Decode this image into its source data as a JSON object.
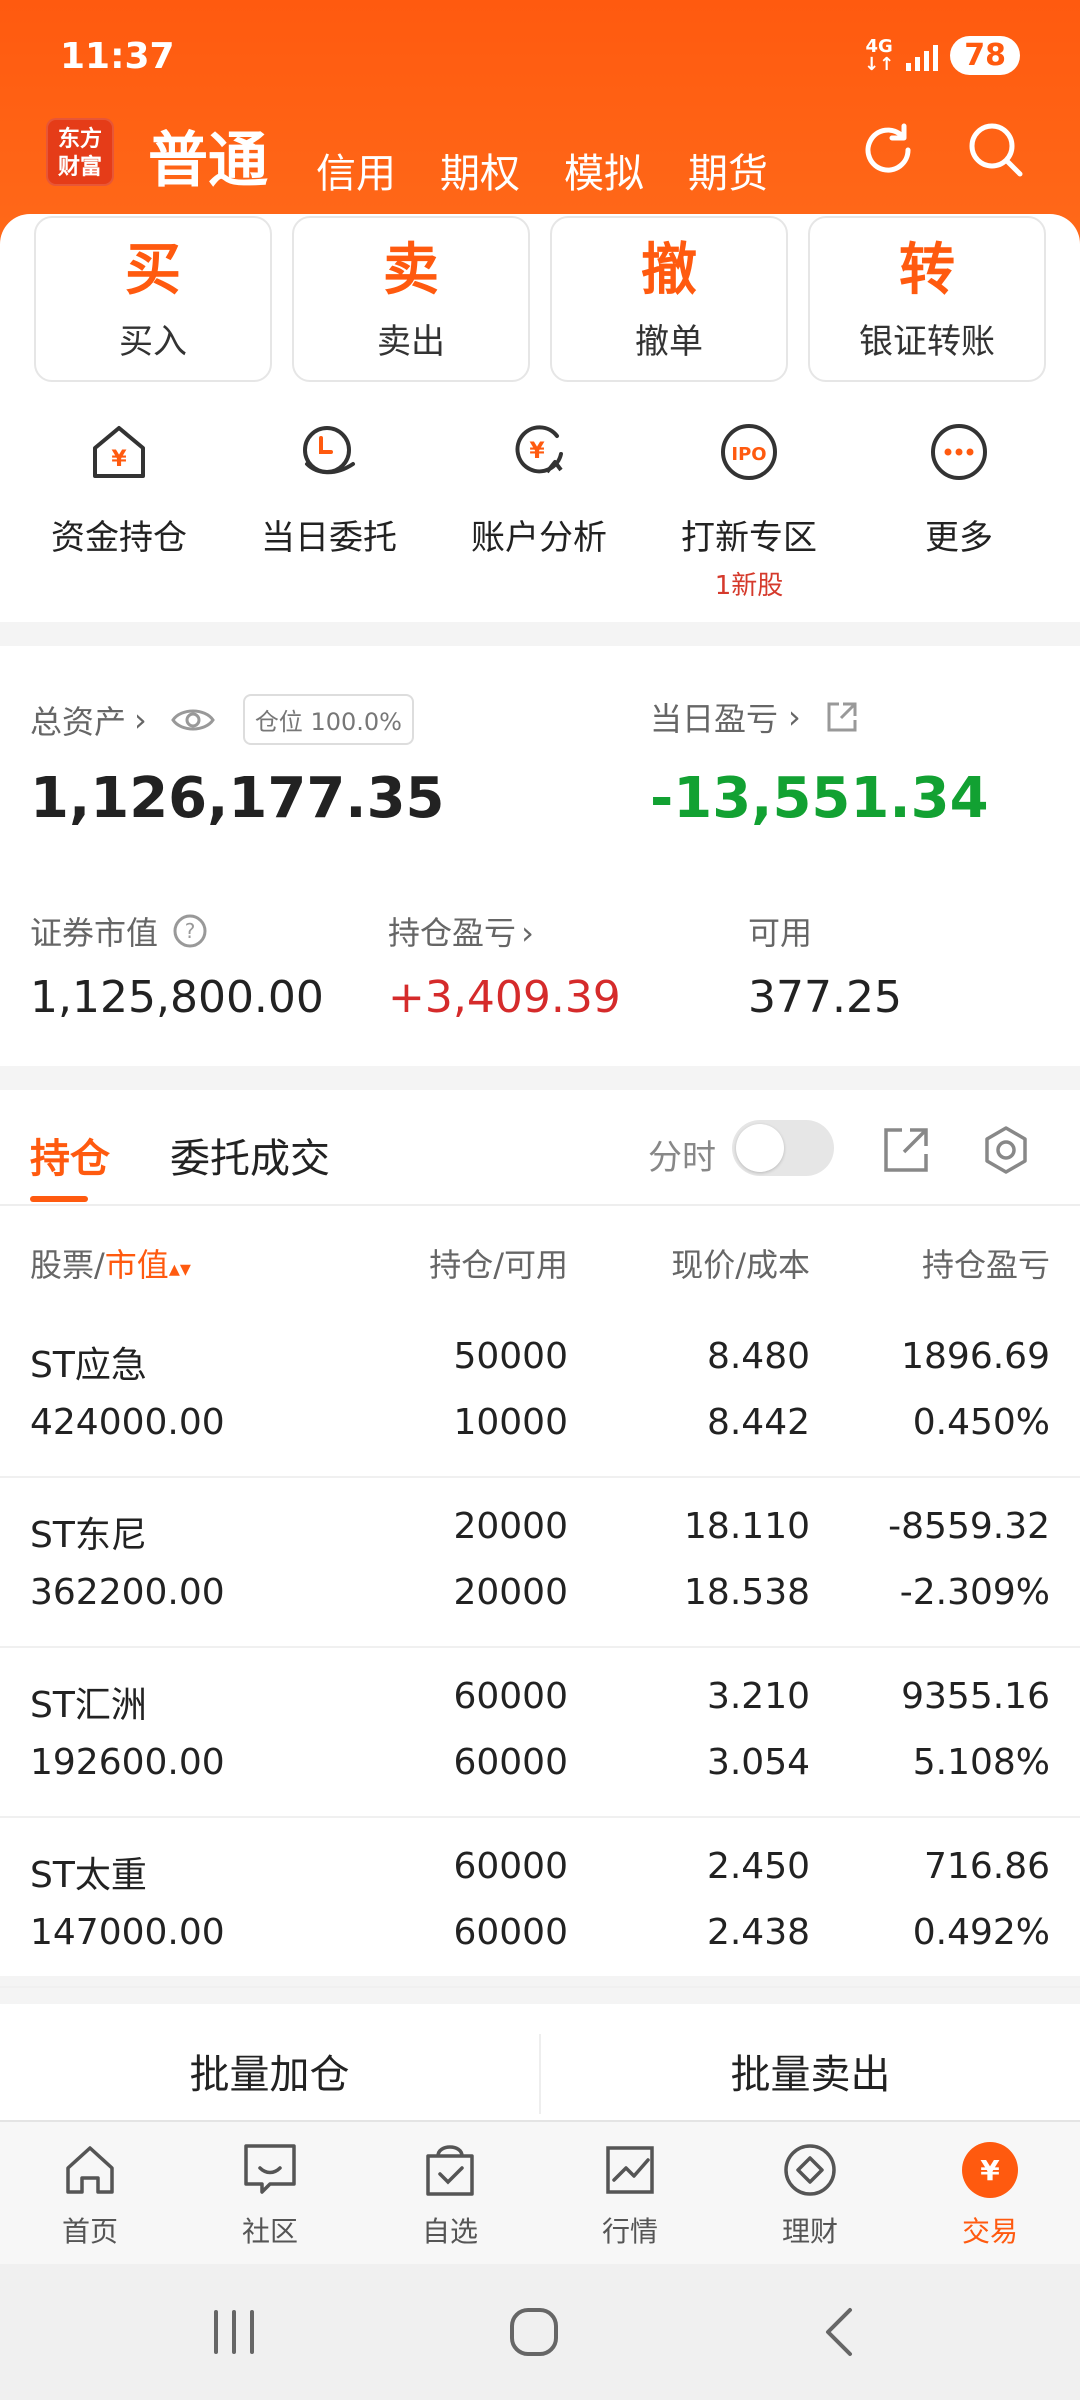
{
  "status": {
    "time": "11:37",
    "network": "4G",
    "battery": "78"
  },
  "header": {
    "logo": [
      "东方",
      "财富"
    ],
    "tabs": [
      {
        "label": "普通",
        "active": true
      },
      {
        "label": "信用"
      },
      {
        "label": "期权"
      },
      {
        "label": "模拟"
      },
      {
        "label": "期货"
      }
    ],
    "icons": [
      "refresh-icon",
      "search-icon"
    ]
  },
  "quick_actions": [
    {
      "big": "买",
      "label": "买入"
    },
    {
      "big": "卖",
      "label": "卖出"
    },
    {
      "big": "撤",
      "label": "撤单"
    },
    {
      "big": "转",
      "label": "银证转账"
    }
  ],
  "functions": [
    {
      "label": "资金持仓",
      "icon": "funds-position-icon"
    },
    {
      "label": "当日委托",
      "icon": "daily-order-icon"
    },
    {
      "label": "账户分析",
      "icon": "account-analysis-icon"
    },
    {
      "label": "打新专区",
      "icon": "ipo-icon",
      "sub": "1新股"
    },
    {
      "label": "更多",
      "icon": "more-icon"
    }
  ],
  "assets": {
    "total_label": "总资产",
    "position_badge": "仓位 100.0%",
    "total_value": "1,126,177.35",
    "day_pl_label": "当日盈亏",
    "day_pl_value": "-13,551.34",
    "market_value_label": "证券市值",
    "market_value": "1,125,800.00",
    "holding_pl_label": "持仓盈亏",
    "holding_pl": "+3,409.39",
    "available_label": "可用",
    "available": "377.25"
  },
  "positions": {
    "tabs": [
      "持仓",
      "委托成交"
    ],
    "fenshi_label": "分时",
    "headers": {
      "stock": "股票/",
      "mv": "市值",
      "qty": "持仓/可用",
      "price": "现价/成本",
      "pl": "持仓盈亏"
    },
    "rows": [
      {
        "name": "ST应急",
        "mv": "424000.00",
        "qty": "50000",
        "avail": "10000",
        "price": "8.480",
        "cost": "8.442",
        "pl": "1896.69",
        "pct": "0.450%",
        "up": true
      },
      {
        "name": "ST东尼",
        "mv": "362200.00",
        "qty": "20000",
        "avail": "20000",
        "price": "18.110",
        "cost": "18.538",
        "pl": "-8559.32",
        "pct": "-2.309%",
        "up": false
      },
      {
        "name": "ST汇洲",
        "mv": "192600.00",
        "qty": "60000",
        "avail": "60000",
        "price": "3.210",
        "cost": "3.054",
        "pl": "9355.16",
        "pct": "5.108%",
        "up": true
      },
      {
        "name": "ST太重",
        "mv": "147000.00",
        "qty": "60000",
        "avail": "60000",
        "price": "2.450",
        "cost": "2.438",
        "pl": "716.86",
        "pct": "0.492%",
        "up": true
      }
    ]
  },
  "batch": {
    "add": "批量加仓",
    "sell": "批量卖出"
  },
  "bottom_nav": [
    {
      "label": "首页",
      "icon": "home-icon"
    },
    {
      "label": "社区",
      "icon": "community-icon"
    },
    {
      "label": "自选",
      "icon": "watchlist-icon"
    },
    {
      "label": "行情",
      "icon": "market-icon"
    },
    {
      "label": "理财",
      "icon": "wealth-icon"
    },
    {
      "label": "交易",
      "icon": "trade-icon",
      "active": true
    }
  ],
  "colors": {
    "accent": "#ff5a0f",
    "up": "#d52b2b",
    "down": "#12a132"
  }
}
